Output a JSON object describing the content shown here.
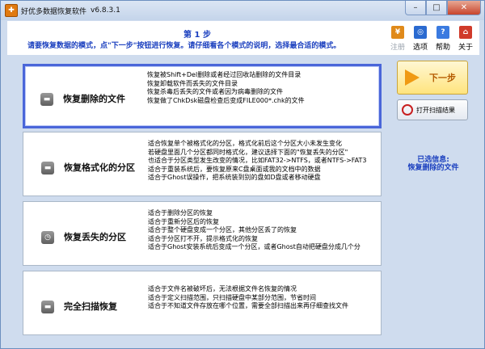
{
  "window": {
    "title": "好优多数据恢复软件",
    "version": "v6.8.3.1",
    "minimize": "–",
    "maximize": "□",
    "close": "✕"
  },
  "header": {
    "step": "第 1 步",
    "instruction": "请要恢复数据的模式，点\"下一步\"按钮进行恢复。请仔细看各个模式的说明，选择最合适的模式。"
  },
  "toolbar": {
    "register": {
      "label": "注册",
      "icon": "cart-icon",
      "color": "#e08a1a"
    },
    "options": {
      "label": "选项",
      "icon": "options-icon",
      "color": "#2a6ad0"
    },
    "help": {
      "label": "帮助",
      "icon": "help-icon",
      "color": "#3a7ae0"
    },
    "about": {
      "label": "关于",
      "icon": "home-icon",
      "color": "#d03a2a"
    }
  },
  "modes": [
    {
      "name": "恢复删除的文件",
      "icon": "disk-icon",
      "selected": true,
      "lines": [
        "恢复被Shift+Del删除或者经过回收站删除的文件目录",
        "恢复卸载软件而丢失的文件目录",
        "恢复杀毒后丢失的文件或者因为病毒删除的文件",
        "恢复做了ChkDsk磁盘检查后变成FILE000*.chk的文件"
      ]
    },
    {
      "name": "恢复格式化的分区",
      "icon": "disk-icon",
      "selected": false,
      "lines": [
        "适合恢复单个被格式化的分区，格式化前后这个分区大小未发生变化",
        "若硬盘里面几个分区都同时格式化，建议选择下面的\"恢复丢失的分区\"",
        "也适合于分区类型发生改变的情况，比如FAT32->NTFS，或者NTFS->FAT3",
        "适合于重装系统后，要恢复原来C盘桌面或我的文档中的数据",
        "适合于Ghost误操作，把系统装到别的盘如D盘或者移动硬盘"
      ]
    },
    {
      "name": "恢复丢失的分区",
      "icon": "clock-icon",
      "selected": false,
      "lines": [
        "适合于删除分区的恢复",
        "适合于重新分区后的恢复",
        "适合于整个硬盘变成一个分区，其他分区丢了的恢复",
        "适合于分区打不开，提示格式化的恢复",
        "适合于Ghost安装系统后变成一个分区，或者Ghost自动把硬盘分成几个分"
      ]
    },
    {
      "name": "完全扫描恢复",
      "icon": "disk-icon",
      "selected": false,
      "lines": [
        "适合于文件名被破坏后，无法根据文件名恢复的情况",
        "适合于定义扫描范围，只扫描硬盘中某部分范围，节省时间",
        "适合于不知道文件存放在哪个位置，需要全部扫描出来再仔细查找文件"
      ]
    }
  ],
  "actions": {
    "next_label": "下一步",
    "open_scan_label": "打开扫描结果"
  },
  "status": {
    "selected_label": "已选信息:",
    "selected_value": "恢复删除的文件"
  }
}
